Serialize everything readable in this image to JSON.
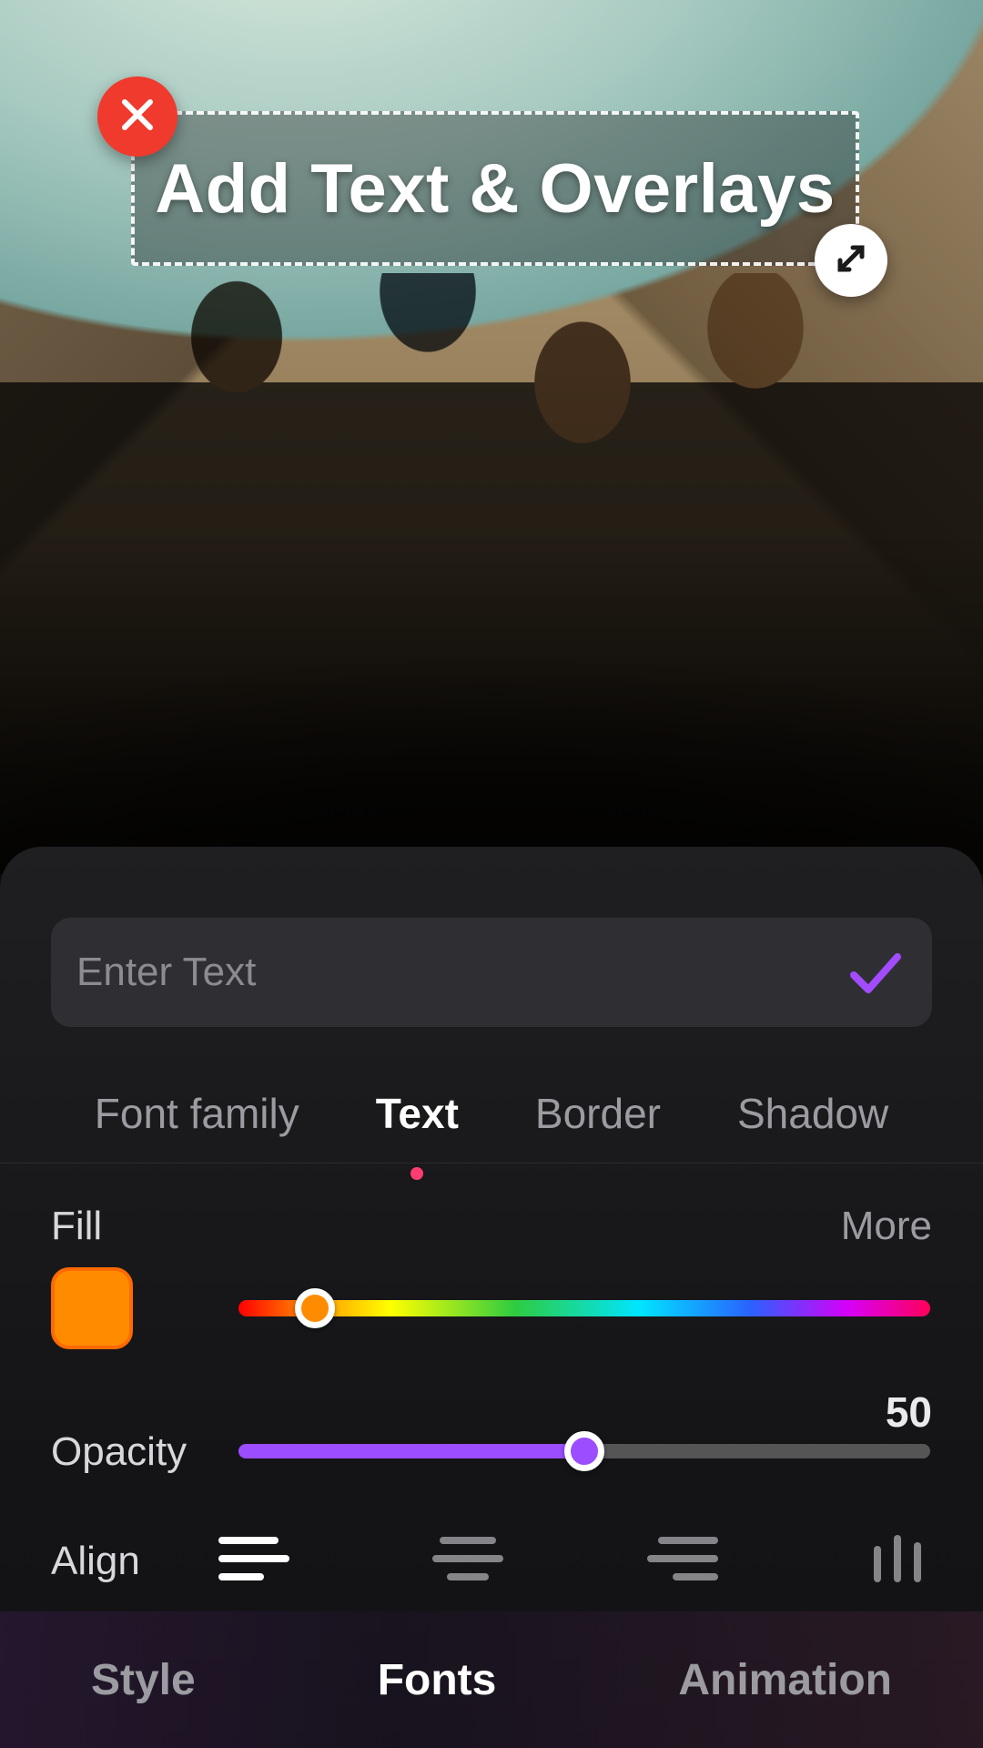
{
  "overlay": {
    "text": "Add Text & Overlays"
  },
  "input": {
    "placeholder": "Enter Text",
    "value": ""
  },
  "subtabs": {
    "items": [
      "Font family",
      "Text",
      "Border",
      "Shadow"
    ],
    "active_index": 1
  },
  "fill": {
    "label": "Fill",
    "more_label": "More",
    "swatch_hex": "#ff8c00",
    "hue_percent": 11
  },
  "opacity": {
    "label": "Opacity",
    "value": 50
  },
  "align": {
    "label": "Align",
    "active_index": 0
  },
  "maintabs": {
    "items": [
      "Style",
      "Fonts",
      "Animation"
    ],
    "active_index": 1
  },
  "icons": {
    "close": "close-icon",
    "resize": "resize-icon",
    "confirm": "check-icon",
    "align_left": "align-left-icon",
    "align_center": "align-center-icon",
    "align_right": "align-right-icon",
    "align_vertical": "vertical-bars-icon"
  },
  "colors": {
    "accent_purple": "#9b4dff",
    "danger_red": "#ef3a2d",
    "swatch": "#ff8c00",
    "indicator_pink": "#ff3d73"
  }
}
